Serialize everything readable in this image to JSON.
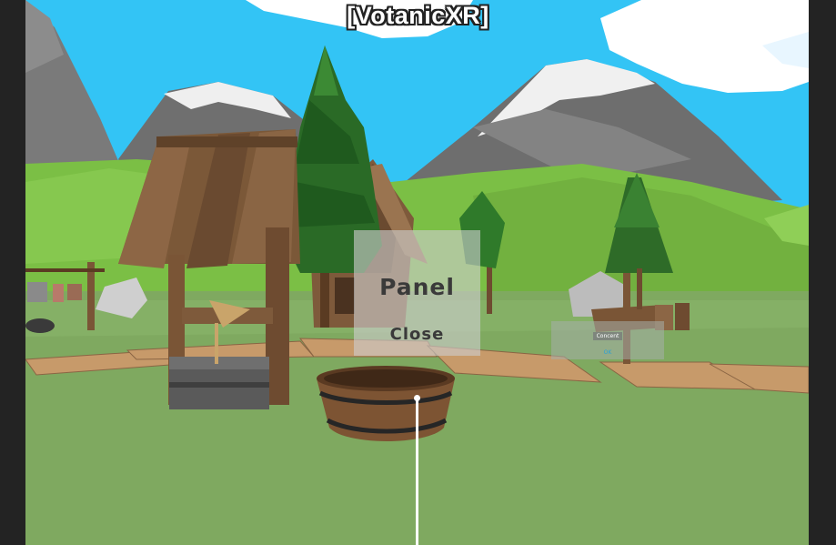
{
  "app": {
    "title": "[VotanicXR]"
  },
  "panel": {
    "title": "Panel",
    "close_label": "Close"
  },
  "far_panel": {
    "button_label": "Concent",
    "ok_label": "OK"
  },
  "colors": {
    "sky": "#33c4f5",
    "grass": "#7fc04c",
    "ground": "#7fa960",
    "mountain": "#777777",
    "snow": "#f2f2f2",
    "wood": "#8a6544",
    "pine": "#2f6e2a",
    "ray": "#ffffff"
  }
}
